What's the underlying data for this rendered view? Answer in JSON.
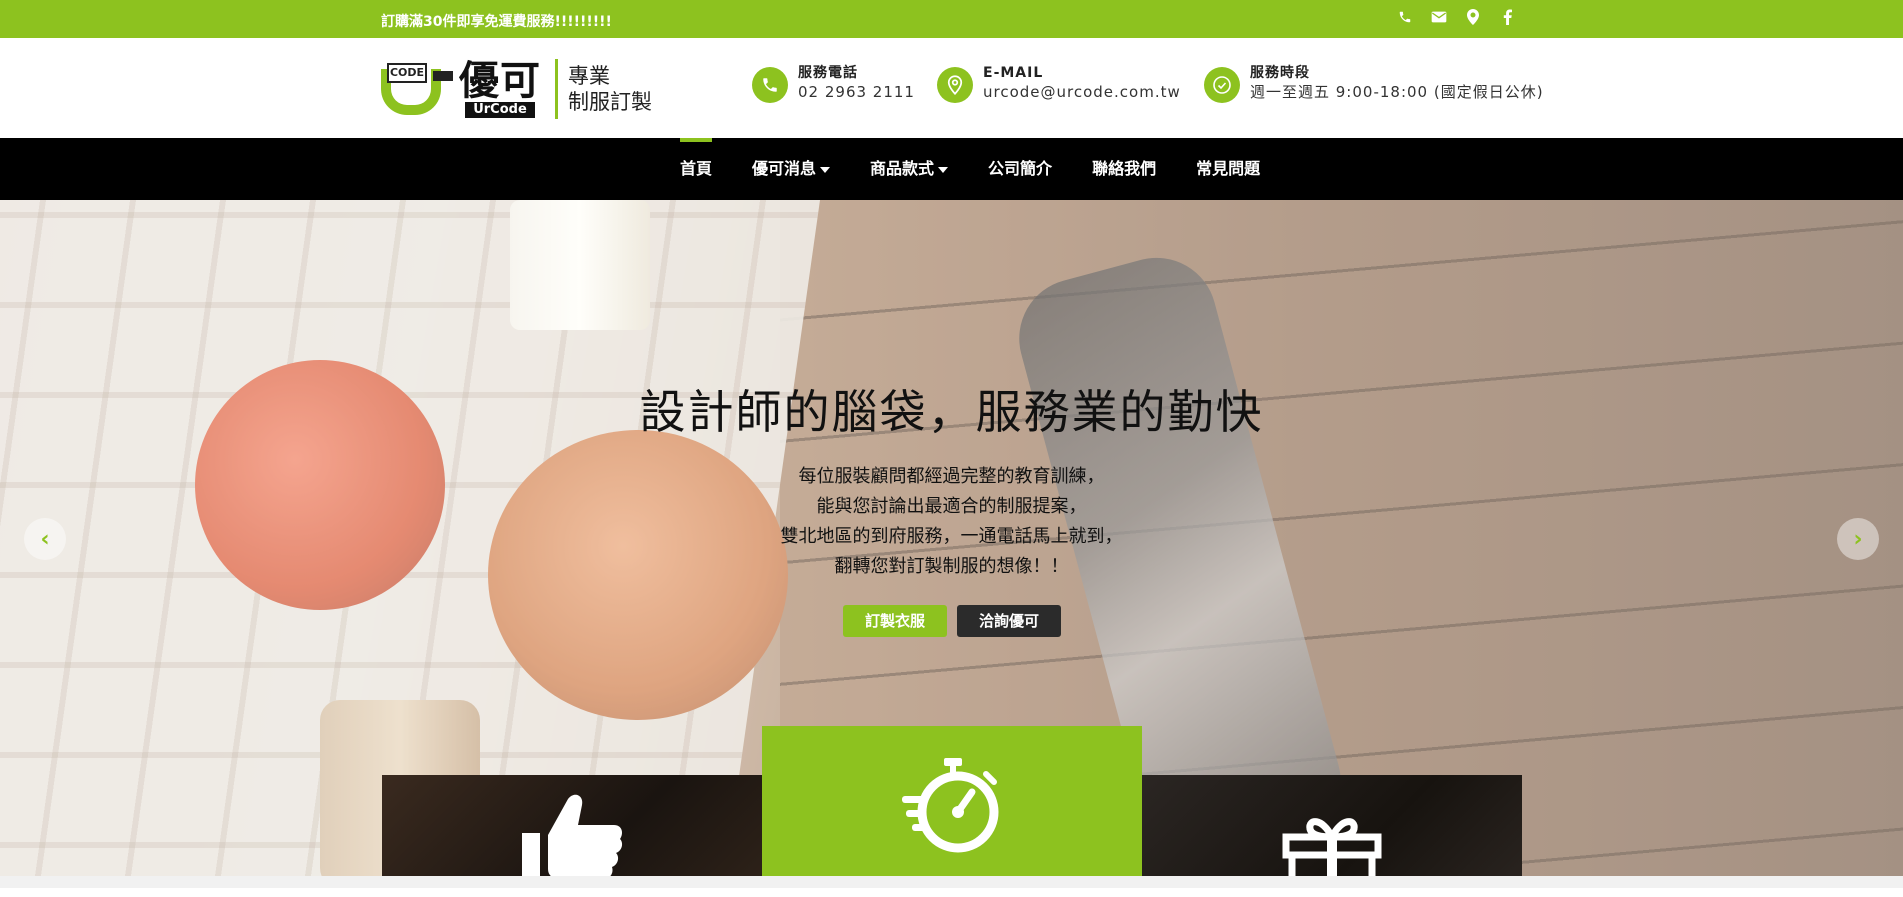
{
  "topbar": {
    "promo": "訂購滿30件即享免運費服務!!!!!!!!!",
    "icons": [
      "phone-icon",
      "envelope-icon",
      "map-marker-icon",
      "facebook-icon"
    ]
  },
  "logo": {
    "code": "CODE",
    "name": "優可",
    "en": "UrCode",
    "tag_line1": "專業",
    "tag_line2": "制服訂製"
  },
  "contact": {
    "phone": {
      "label": "服務電話",
      "value": "02 2963 2111"
    },
    "email": {
      "label": "E-MAIL",
      "value": "urcode@urcode.com.tw"
    },
    "hours": {
      "label": "服務時段",
      "value": "週一至週五 9:00-18:00 (國定假日公休)"
    }
  },
  "nav": {
    "items": [
      {
        "label": "首頁",
        "active": true,
        "dropdown": false
      },
      {
        "label": "優可消息",
        "active": false,
        "dropdown": true
      },
      {
        "label": "商品款式",
        "active": false,
        "dropdown": true
      },
      {
        "label": "公司簡介",
        "active": false,
        "dropdown": false
      },
      {
        "label": "聯絡我們",
        "active": false,
        "dropdown": false
      },
      {
        "label": "常見問題",
        "active": false,
        "dropdown": false
      }
    ]
  },
  "hero": {
    "headline": "設計師的腦袋，服務業的勤快",
    "lines": [
      "每位服裝顧問都經過完整的教育訓練，",
      "能與您討論出最適合的制服提案，",
      "雙北地區的到府服務，一通電話馬上就到，",
      "翻轉您對訂製制服的想像！！"
    ],
    "btn_primary": "訂製衣服",
    "btn_secondary": "洽詢優可",
    "prev": "‹",
    "next": "›"
  },
  "colors": {
    "accent": "#8dc21f",
    "nav_bg": "#000000"
  }
}
